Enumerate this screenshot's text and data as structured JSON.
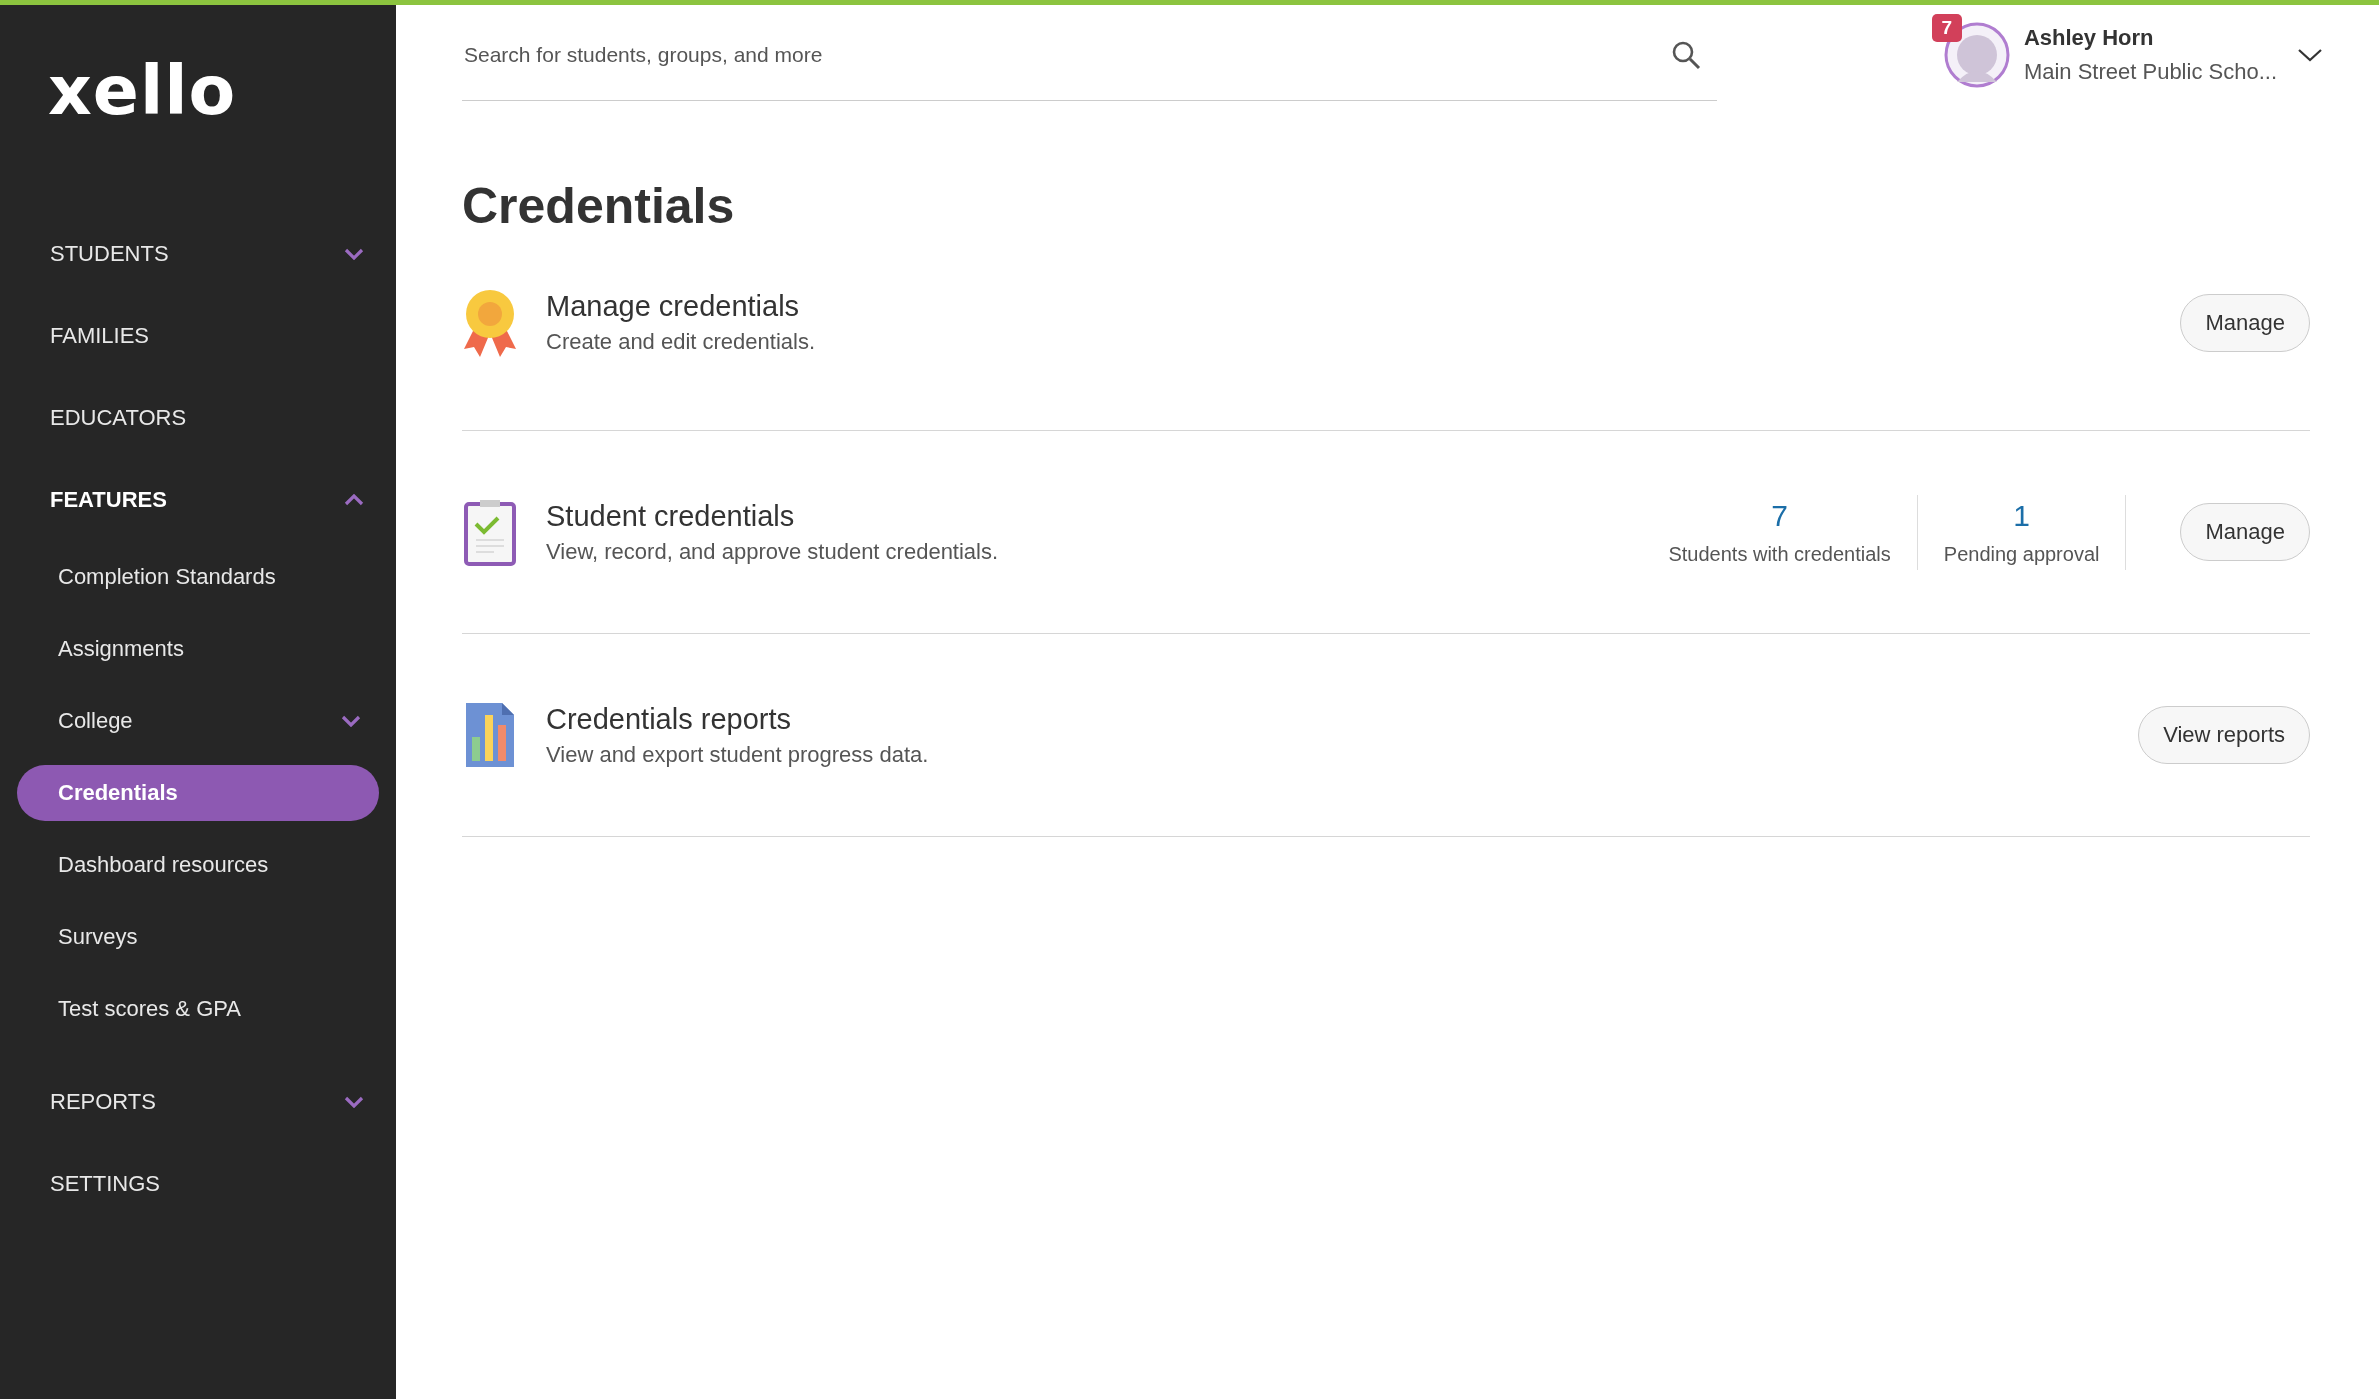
{
  "sidebar": {
    "logo": "xello",
    "items": [
      {
        "label": "STUDENTS",
        "expanded": false
      },
      {
        "label": "FAMILIES"
      },
      {
        "label": "EDUCATORS"
      },
      {
        "label": "FEATURES",
        "expanded": true,
        "children": [
          {
            "label": "Completion Standards",
            "selected": false
          },
          {
            "label": "Assignments",
            "selected": false
          },
          {
            "label": "College",
            "selected": false,
            "expanded": false
          },
          {
            "label": "Credentials",
            "selected": true
          },
          {
            "label": "Dashboard resources",
            "selected": false
          },
          {
            "label": "Surveys",
            "selected": false
          },
          {
            "label": "Test scores & GPA",
            "selected": false
          }
        ]
      },
      {
        "label": "REPORTS",
        "expanded": false
      },
      {
        "label": "SETTINGS"
      }
    ]
  },
  "search": {
    "placeholder": "Search for students, groups, and more"
  },
  "user": {
    "notifications": "7",
    "name": "Ashley Horn",
    "school": "Main Street Public Scho..."
  },
  "page_title": "Credentials",
  "sections": [
    {
      "kind": "award",
      "title": "Manage credentials",
      "description": "Create and edit credentials.",
      "button": "Manage"
    },
    {
      "kind": "clipboard",
      "title": "Student credentials",
      "description": "View, record, and approve student credentials.",
      "stats": [
        {
          "value": "7",
          "label": "Students with credentials"
        },
        {
          "value": "1",
          "label": "Pending approval"
        }
      ],
      "button": "Manage"
    },
    {
      "kind": "report",
      "title": "Credentials reports",
      "description": "View and export student progress data.",
      "button": "View reports"
    }
  ]
}
